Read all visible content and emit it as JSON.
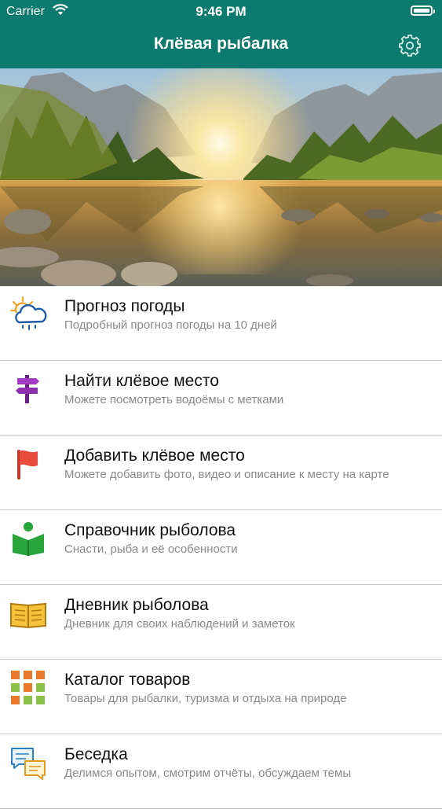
{
  "status_bar": {
    "carrier": "Carrier",
    "time": "9:46 PM"
  },
  "header": {
    "title": "Клёвая рыбалка",
    "settings_icon": "gear-icon"
  },
  "colors": {
    "header_bg": "#0c7a6c",
    "divider": "#c8c8c8",
    "subtitle": "#8a8a8a"
  },
  "menu": [
    {
      "title": "Прогноз погоды",
      "subtitle": "Подробный прогноз погоды на 10 дней",
      "icon": "weather-icon"
    },
    {
      "title": "Найти клёвое место",
      "subtitle": "Можете посмотреть водоёмы с метками",
      "icon": "signpost-icon"
    },
    {
      "title": "Добавить клёвое место",
      "subtitle": "Можете добавить фото, видео и описание к месту на карте",
      "icon": "flag-icon"
    },
    {
      "title": "Справочник рыболова",
      "subtitle": "Снасти, рыба и её особенности",
      "icon": "reader-book-icon"
    },
    {
      "title": "Дневник рыболова",
      "subtitle": "Дневник для своих наблюдений и заметок",
      "icon": "open-book-icon"
    },
    {
      "title": "Каталог товаров",
      "subtitle": "Товары для рыбалки, туризма и отдыха на природе",
      "icon": "catalog-grid-icon"
    },
    {
      "title": "Беседка",
      "subtitle": "Делимся опытом, смотрим отчёты, обсуждаем темы",
      "icon": "chat-bubbles-icon"
    }
  ]
}
